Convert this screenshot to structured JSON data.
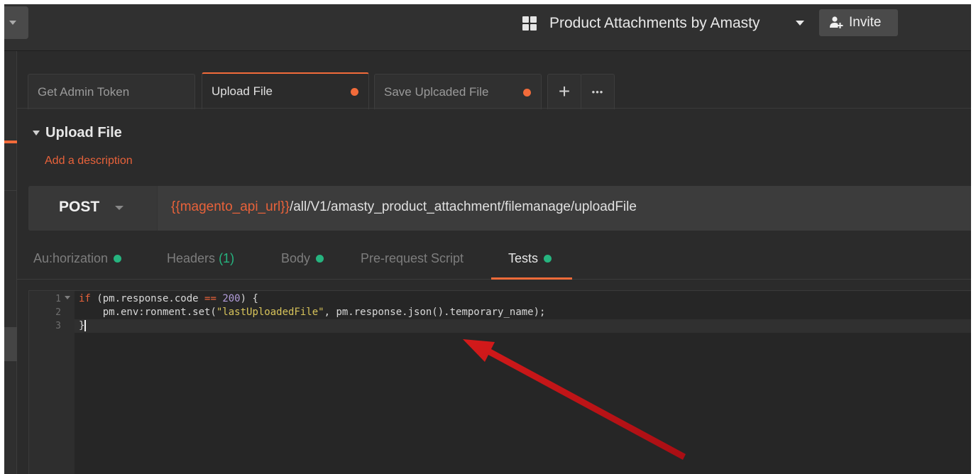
{
  "workspace": {
    "name": "Product Attachments by Amasty",
    "invite_label": "Invite"
  },
  "tabs": [
    {
      "label": "Get Admin Token",
      "unsaved": false,
      "active": false
    },
    {
      "label": "Upload File",
      "unsaved": true,
      "active": true
    },
    {
      "label": "Save Uplcaded File",
      "unsaved": true,
      "active": false
    }
  ],
  "tab_actions": {
    "new_tab": "+",
    "more": "•••"
  },
  "request": {
    "name": "Upload File",
    "add_description": "Add a description",
    "method": "POST",
    "url_variable": "{{magento_api_url}}",
    "url_path": "/all/V1/amasty_product_attachment/filemanage/uploadFile"
  },
  "subtabs": {
    "authorization": "Au:horization",
    "headers": "Headers",
    "headers_count": "(1)",
    "body": "Body",
    "prerequest": "Pre-request Script",
    "tests": "Tests"
  },
  "editor": {
    "line_numbers": [
      "1",
      "2",
      "3"
    ],
    "line1": {
      "kw": "if",
      "a": " (pm.response.code ",
      "op": "==",
      "b": " ",
      "num": "200",
      "c": ") {"
    },
    "line2": {
      "a": "    pm.env:ronment.set(",
      "str": "\"lastUploadedFile\"",
      "b": ", pm.response.json().temporary_name);"
    },
    "line3": {
      "a": "}"
    }
  },
  "colors": {
    "accent": "#f26b3a",
    "status_green": "#26b47f",
    "annotation_arrow": "#c0121a"
  },
  "icons": [
    "caret-down-icon",
    "workspace-grid-icon",
    "add-user-icon",
    "plus-icon",
    "more-icon",
    "status-dot-icon",
    "fold-icon"
  ]
}
